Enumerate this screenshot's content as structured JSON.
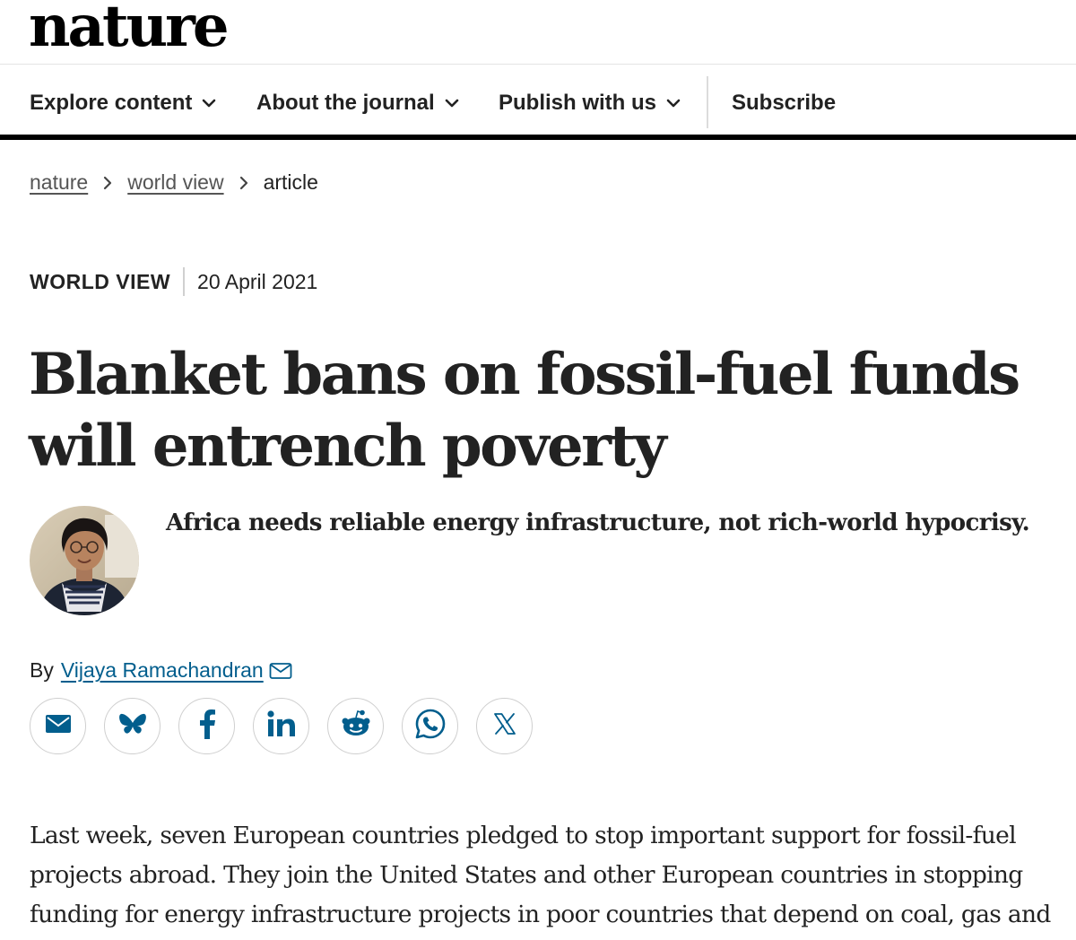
{
  "site": {
    "logo": "nature"
  },
  "nav": {
    "items": [
      {
        "label": "Explore content"
      },
      {
        "label": "About the journal"
      },
      {
        "label": "Publish with us"
      }
    ],
    "subscribe": "Subscribe"
  },
  "breadcrumb": {
    "items": [
      "nature",
      "world view"
    ],
    "current": "article"
  },
  "article": {
    "type": "WORLD VIEW",
    "date": "20 April 2021",
    "title": "Blanket bans on fossil-fuel funds will entrench poverty",
    "standfirst": "Africa needs reliable energy infrastructure, not rich-world hypocrisy.",
    "byline_prefix": "By",
    "author": "Vijaya Ramachandran",
    "body": [
      "Last week, seven European countries pledged to stop important support for fossil-fuel",
      "projects abroad. They join the United States and other European countries in stopping",
      "funding for energy infrastructure projects in poor countries that depend on coal, gas and oil."
    ]
  },
  "share": {
    "icons": [
      "email-icon",
      "bluesky-icon",
      "facebook-icon",
      "linkedin-icon",
      "reddit-icon",
      "whatsapp-icon",
      "x-icon"
    ]
  },
  "colors": {
    "link": "#025e8d",
    "icon": "#025e8d",
    "text": "#222222"
  }
}
